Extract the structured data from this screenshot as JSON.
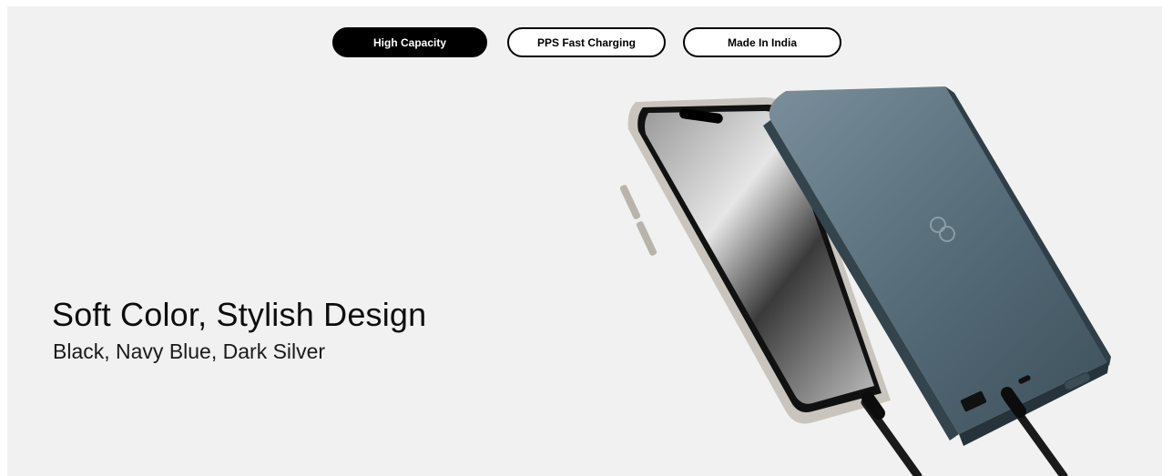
{
  "tabs": [
    {
      "label": "High Capacity",
      "active": true
    },
    {
      "label": "PPS Fast Charging",
      "active": false
    },
    {
      "label": "Made In India",
      "active": false
    }
  ],
  "hero": {
    "title": "Soft Color, Stylish Design",
    "subtitle": "Black, Navy Blue, Dark Silver"
  },
  "colors": {
    "background": "#f1f1f1",
    "tab_active_bg": "#000000",
    "power_bank": "#4a5f6b"
  }
}
